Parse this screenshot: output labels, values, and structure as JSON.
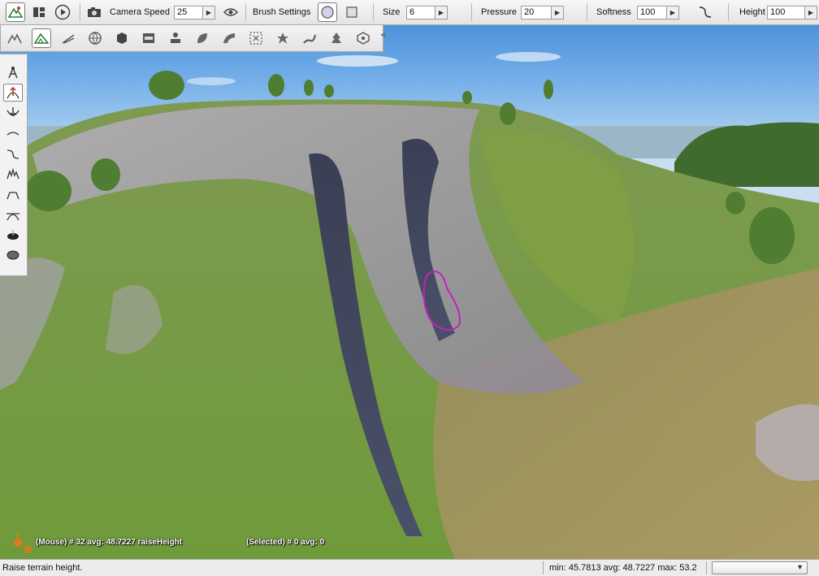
{
  "toolbar": {
    "camera_speed_label": "Camera Speed",
    "camera_speed_value": "25",
    "brush_settings_label": "Brush Settings",
    "size_label": "Size",
    "size_value": "6",
    "pressure_label": "Pressure",
    "pressure_value": "20",
    "softness_label": "Softness",
    "softness_value": "100",
    "height_label": "Height",
    "height_value": "100"
  },
  "toolbar2": {
    "icons": [
      "terrain-editor-icon",
      "terrain-painter-icon",
      "road-tool-icon",
      "world-icon",
      "object-box-icon",
      "data-icon",
      "object-editor-icon",
      "leaf-icon",
      "mesh-road-icon",
      "selection-icon",
      "decal-icon",
      "river-icon",
      "forest-icon",
      "navmesh-icon"
    ]
  },
  "palette": {
    "tools": [
      "select-tool",
      "raise-height",
      "lower-height",
      "smooth",
      "smooth-slope",
      "paint-noise",
      "flatten",
      "adjust-height",
      "clear-terrain",
      "paint-material"
    ]
  },
  "overlay": {
    "mouse_info": "(Mouse) # 32  avg: 48.7227 raiseHeight",
    "selected_info": "(Selected) # 0  avg: 0"
  },
  "status": {
    "message": "Raise terrain height.",
    "stats": "min: 45.7813  avg: 48.7227  max: 53.2",
    "select_value": ""
  },
  "colors": {
    "brush_outline": "#c41fc4",
    "accent_red": "#c0392b"
  }
}
